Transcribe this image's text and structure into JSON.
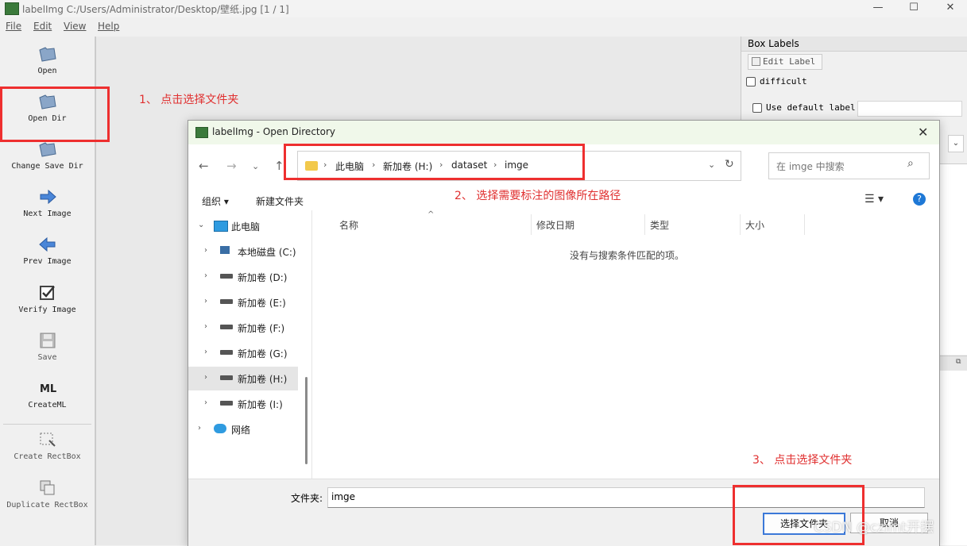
{
  "window": {
    "title": "labelImg C:/Users/Administrator/Desktop/壁纸.jpg [1 / 1]",
    "controls": {
      "minimize": "—",
      "maximize": "☐",
      "close": "✕"
    }
  },
  "menu": [
    "File",
    "Edit",
    "View",
    "Help"
  ],
  "toolbar": [
    {
      "label": "Open"
    },
    {
      "label": "Open Dir"
    },
    {
      "label": "Change Save Dir"
    },
    {
      "label": "Next Image"
    },
    {
      "label": "Prev Image"
    },
    {
      "label": "Verify Image"
    },
    {
      "label": "Save"
    },
    {
      "label": "CreateML"
    },
    {
      "label": "Create RectBox"
    },
    {
      "label": "Duplicate RectBox"
    }
  ],
  "right_panel": {
    "title": "Box Labels",
    "edit_label": "Edit Label",
    "difficult": "difficult",
    "use_default": "Use default label"
  },
  "annotations": {
    "step1": "1、 点击选择文件夹",
    "step2": "2、 选择需要标注的图像所在路径",
    "step3": "3、 点击选择文件夹"
  },
  "dialog": {
    "title": "labelImg - Open Directory",
    "breadcrumb": [
      "此电脑",
      "新加卷 (H:)",
      "dataset",
      "imge"
    ],
    "search_placeholder": "在 imge 中搜索",
    "organize": "组织",
    "new_folder": "新建文件夹",
    "columns": [
      "名称",
      "修改日期",
      "类型",
      "大小"
    ],
    "empty_message": "没有与搜索条件匹配的项。",
    "nav_tree": [
      {
        "label": "此电脑",
        "level": 0,
        "expanded": true
      },
      {
        "label": "本地磁盘 (C:)",
        "level": 1
      },
      {
        "label": "新加卷 (D:)",
        "level": 1
      },
      {
        "label": "新加卷 (E:)",
        "level": 1
      },
      {
        "label": "新加卷 (F:)",
        "level": 1
      },
      {
        "label": "新加卷 (G:)",
        "level": 1
      },
      {
        "label": "新加卷 (H:)",
        "level": 1,
        "selected": true
      },
      {
        "label": "新加卷 (I:)",
        "level": 1
      },
      {
        "label": "网络",
        "level": 0
      }
    ],
    "folder_label": "文件夹:",
    "folder_value": "imge",
    "select_button": "选择文件夹",
    "cancel_button": "取消"
  },
  "watermark": "CSDN @czimt开摆"
}
